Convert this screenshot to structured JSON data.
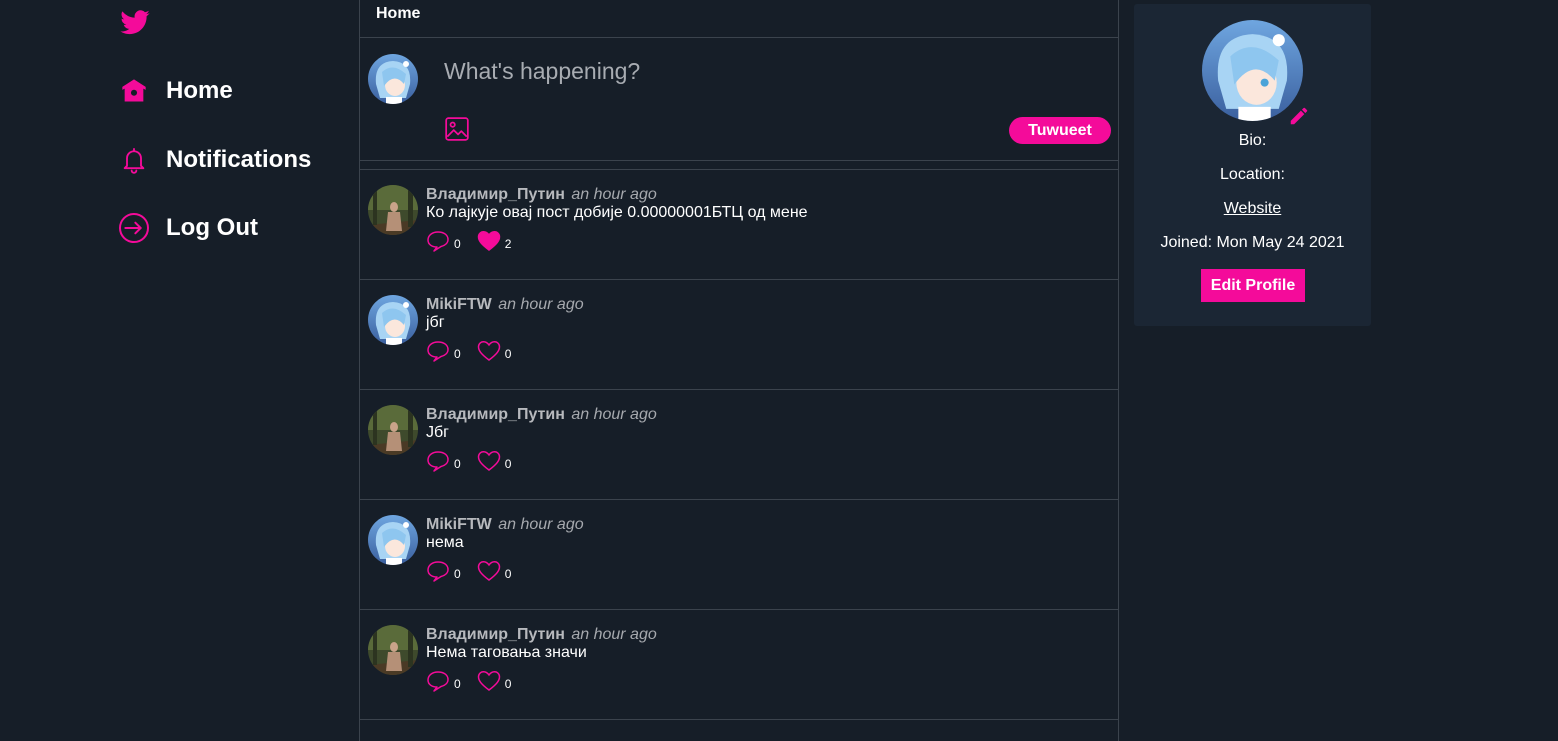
{
  "colors": {
    "background": "#161e28",
    "accent": "#f40b9a",
    "border": "#3b434d",
    "panel": "#1b2634",
    "muted_text": "#b7b9bd"
  },
  "nav": {
    "logo_icon": "twitter-bird-icon",
    "items": [
      {
        "label": "Home",
        "icon": "home-icon"
      },
      {
        "label": "Notifications",
        "icon": "bell-icon"
      },
      {
        "label": "Log Out",
        "icon": "logout-icon"
      }
    ]
  },
  "feed": {
    "header_title": "Home",
    "composer": {
      "placeholder": "What's happening?",
      "image_icon": "image-icon",
      "tweet_button_label": "Tuwueet"
    },
    "posts": [
      {
        "author": "Владимир_Путин",
        "time": "an hour ago",
        "text": "Ко лајкује овај пост добије 0.00000001БТЦ од мене",
        "comments": "0",
        "likes": "2",
        "liked": true,
        "avatar": "forest"
      },
      {
        "author": "MikiFTW",
        "time": "an hour ago",
        "text": "јбг",
        "comments": "0",
        "likes": "0",
        "liked": false,
        "avatar": "anime"
      },
      {
        "author": "Владимир_Путин",
        "time": "an hour ago",
        "text": "Јбг",
        "comments": "0",
        "likes": "0",
        "liked": false,
        "avatar": "forest"
      },
      {
        "author": "MikiFTW",
        "time": "an hour ago",
        "text": "нема",
        "comments": "0",
        "likes": "0",
        "liked": false,
        "avatar": "anime"
      },
      {
        "author": "Владимир_Путин",
        "time": "an hour ago",
        "text": "Нема таговања значи",
        "comments": "0",
        "likes": "0",
        "liked": false,
        "avatar": "forest"
      }
    ]
  },
  "profile": {
    "bio_label": "Bio:",
    "location_label": "Location:",
    "website_label": "Website",
    "joined_text": "Joined: Mon May 24 2021",
    "edit_button_label": "Edit Profile",
    "edit_icon": "pencil-icon"
  }
}
